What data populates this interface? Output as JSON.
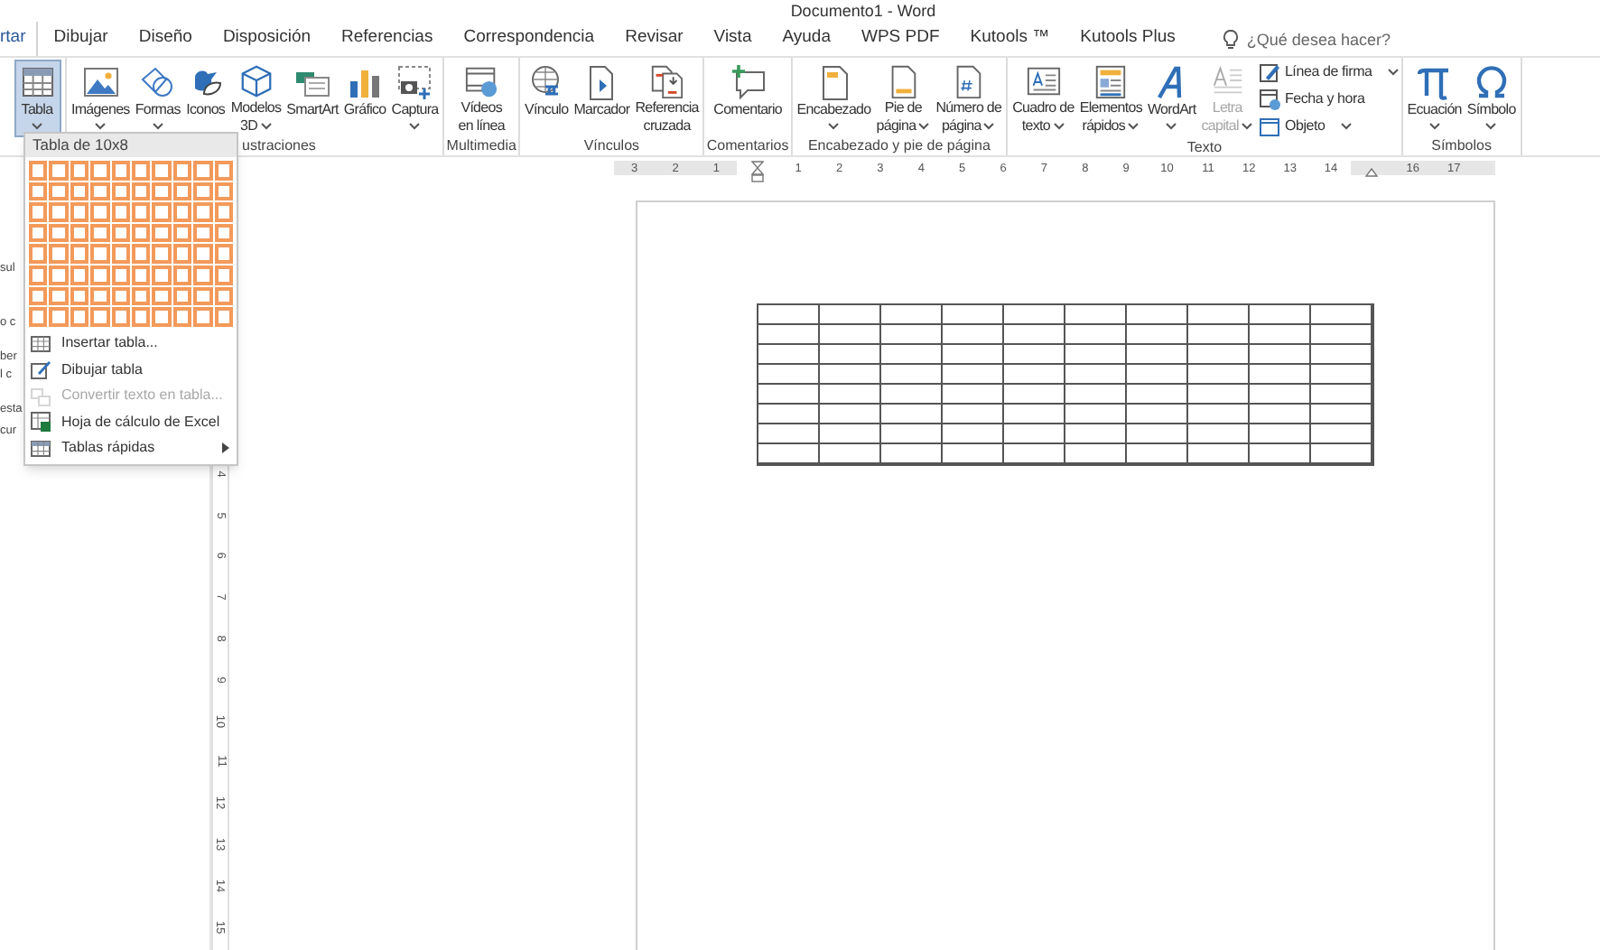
{
  "window": {
    "title": "Documento1 - Word"
  },
  "tabs": [
    {
      "label": "rtar",
      "selected": true
    },
    {
      "label": "Dibujar",
      "selected": false
    },
    {
      "label": "Diseño",
      "selected": false
    },
    {
      "label": "Disposición",
      "selected": false
    },
    {
      "label": "Referencias",
      "selected": false
    },
    {
      "label": "Correspondencia",
      "selected": false
    },
    {
      "label": "Revisar",
      "selected": false
    },
    {
      "label": "Vista",
      "selected": false
    },
    {
      "label": "Ayuda",
      "selected": false
    },
    {
      "label": "WPS PDF",
      "selected": false
    },
    {
      "label": "Kutools ™",
      "selected": false
    },
    {
      "label": "Kutools Plus",
      "selected": false
    }
  ],
  "tell_me": {
    "placeholder": "¿Qué desea hacer?"
  },
  "ribbon": {
    "groups": [
      {
        "buttons": [
          {
            "label_lines": [
              "Tabla"
            ],
            "dropdown": true,
            "selected": true,
            "disabled": false
          }
        ]
      },
      {
        "label": "ustraciones",
        "buttons": [
          {
            "label_lines": [
              "Imágenes"
            ],
            "dropdown": true,
            "selected": false,
            "disabled": false
          },
          {
            "label_lines": [
              "Formas"
            ],
            "dropdown": true,
            "selected": false,
            "disabled": false
          },
          {
            "label_lines": [
              "Iconos"
            ],
            "dropdown": false,
            "selected": false,
            "disabled": false
          },
          {
            "label_lines": [
              "Modelos",
              "3D"
            ],
            "dropdown": true,
            "selected": false,
            "disabled": false
          },
          {
            "label_lines": [
              "SmartArt"
            ],
            "dropdown": false,
            "selected": false,
            "disabled": false
          },
          {
            "label_lines": [
              "Gráfico"
            ],
            "dropdown": false,
            "selected": false,
            "disabled": false
          },
          {
            "label_lines": [
              "Captura"
            ],
            "dropdown": true,
            "selected": false,
            "disabled": false
          }
        ]
      },
      {
        "label": "Multimedia",
        "buttons": [
          {
            "label_lines": [
              "Vídeos",
              "en línea"
            ],
            "dropdown": false,
            "selected": false,
            "disabled": false
          }
        ]
      },
      {
        "label": "Vínculos",
        "buttons": [
          {
            "label_lines": [
              "Vínculo"
            ],
            "dropdown": false,
            "selected": false,
            "disabled": false
          },
          {
            "label_lines": [
              "Marcador"
            ],
            "dropdown": false,
            "selected": false,
            "disabled": false
          },
          {
            "label_lines": [
              "Referencia",
              "cruzada"
            ],
            "dropdown": false,
            "selected": false,
            "disabled": false
          }
        ]
      },
      {
        "label": "Comentarios",
        "buttons": [
          {
            "label_lines": [
              "Comentario"
            ],
            "dropdown": false,
            "selected": false,
            "disabled": false
          }
        ]
      },
      {
        "label": "Encabezado y pie de página",
        "buttons": [
          {
            "label_lines": [
              "Encabezado"
            ],
            "dropdown": true,
            "selected": false,
            "disabled": false
          },
          {
            "label_lines": [
              "Pie de",
              "página"
            ],
            "dropdown": true,
            "selected": false,
            "disabled": false
          },
          {
            "label_lines": [
              "Número de",
              "página"
            ],
            "dropdown": true,
            "selected": false,
            "disabled": false
          }
        ]
      },
      {
        "label": "Texto",
        "buttons": [
          {
            "label_lines": [
              "Cuadro de",
              "texto"
            ],
            "dropdown": true,
            "selected": false,
            "disabled": false
          },
          {
            "label_lines": [
              "Elementos",
              "rápidos"
            ],
            "dropdown": true,
            "selected": false,
            "disabled": false
          },
          {
            "label_lines": [
              "WordArt"
            ],
            "dropdown": true,
            "selected": false,
            "disabled": false
          },
          {
            "label_lines": [
              "Letra",
              "capital"
            ],
            "dropdown": true,
            "selected": false,
            "disabled": true
          }
        ],
        "small_buttons": [
          {
            "label": "Línea de firma",
            "dropdown": true
          },
          {
            "label": "Fecha y hora",
            "dropdown": false
          },
          {
            "label": "Objeto",
            "dropdown": true
          }
        ]
      },
      {
        "label": "Símbolos",
        "buttons": [
          {
            "label_lines": [
              "Ecuación"
            ],
            "dropdown": true,
            "selected": false,
            "disabled": false
          },
          {
            "label_lines": [
              "Símbolo"
            ],
            "dropdown": true,
            "selected": false,
            "disabled": false
          }
        ]
      }
    ]
  },
  "table_menu": {
    "header": "Tabla de 10x8",
    "grid": [
      {
        "cells": [
          {
            "highlighted": true
          },
          {
            "highlighted": true
          },
          {
            "highlighted": true
          },
          {
            "highlighted": true
          },
          {
            "highlighted": true
          },
          {
            "highlighted": true
          },
          {
            "highlighted": true
          },
          {
            "highlighted": true
          },
          {
            "highlighted": true
          },
          {
            "highlighted": true
          }
        ]
      },
      {
        "cells": [
          {
            "highlighted": true
          },
          {
            "highlighted": true
          },
          {
            "highlighted": true
          },
          {
            "highlighted": true
          },
          {
            "highlighted": true
          },
          {
            "highlighted": true
          },
          {
            "highlighted": true
          },
          {
            "highlighted": true
          },
          {
            "highlighted": true
          },
          {
            "highlighted": true
          }
        ]
      },
      {
        "cells": [
          {
            "highlighted": true
          },
          {
            "highlighted": true
          },
          {
            "highlighted": true
          },
          {
            "highlighted": true
          },
          {
            "highlighted": true
          },
          {
            "highlighted": true
          },
          {
            "highlighted": true
          },
          {
            "highlighted": true
          },
          {
            "highlighted": true
          },
          {
            "highlighted": true
          }
        ]
      },
      {
        "cells": [
          {
            "highlighted": true
          },
          {
            "highlighted": true
          },
          {
            "highlighted": true
          },
          {
            "highlighted": true
          },
          {
            "highlighted": true
          },
          {
            "highlighted": true
          },
          {
            "highlighted": true
          },
          {
            "highlighted": true
          },
          {
            "highlighted": true
          },
          {
            "highlighted": true
          }
        ]
      },
      {
        "cells": [
          {
            "highlighted": true
          },
          {
            "highlighted": true
          },
          {
            "highlighted": true
          },
          {
            "highlighted": true
          },
          {
            "highlighted": true
          },
          {
            "highlighted": true
          },
          {
            "highlighted": true
          },
          {
            "highlighted": true
          },
          {
            "highlighted": true
          },
          {
            "highlighted": true
          }
        ]
      },
      {
        "cells": [
          {
            "highlighted": true
          },
          {
            "highlighted": true
          },
          {
            "highlighted": true
          },
          {
            "highlighted": true
          },
          {
            "highlighted": true
          },
          {
            "highlighted": true
          },
          {
            "highlighted": true
          },
          {
            "highlighted": true
          },
          {
            "highlighted": true
          },
          {
            "highlighted": true
          }
        ]
      },
      {
        "cells": [
          {
            "highlighted": true
          },
          {
            "highlighted": true
          },
          {
            "highlighted": true
          },
          {
            "highlighted": true
          },
          {
            "highlighted": true
          },
          {
            "highlighted": true
          },
          {
            "highlighted": true
          },
          {
            "highlighted": true
          },
          {
            "highlighted": true
          },
          {
            "highlighted": true
          }
        ]
      },
      {
        "cells": [
          {
            "highlighted": true
          },
          {
            "highlighted": true
          },
          {
            "highlighted": true
          },
          {
            "highlighted": true
          },
          {
            "highlighted": true
          },
          {
            "highlighted": true
          },
          {
            "highlighted": true
          },
          {
            "highlighted": true
          },
          {
            "highlighted": true
          },
          {
            "highlighted": true
          }
        ]
      }
    ],
    "items": [
      {
        "label": "Insertar tabla...",
        "disabled": false,
        "submenu": false
      },
      {
        "label": "Dibujar tabla",
        "disabled": false,
        "submenu": false
      },
      {
        "label": "Convertir texto en tabla...",
        "disabled": true,
        "submenu": false
      },
      {
        "label": "Hoja de cálculo de Excel",
        "disabled": false,
        "submenu": false
      },
      {
        "label": "Tablas rápidas",
        "disabled": false,
        "submenu": true
      }
    ]
  },
  "navigation_pane_fragments": [
    "sul",
    "o c",
    "ber",
    "l c",
    "esta",
    "cur"
  ],
  "horizontal_ruler": [
    {
      "kind": "number",
      "label": "3"
    },
    {
      "kind": "number",
      "label": "2"
    },
    {
      "kind": "number",
      "label": "1"
    },
    {
      "kind": "indent"
    },
    {
      "kind": "number",
      "label": "1"
    },
    {
      "kind": "number",
      "label": "2"
    },
    {
      "kind": "number",
      "label": "3"
    },
    {
      "kind": "number",
      "label": "4"
    },
    {
      "kind": "number",
      "label": "5"
    },
    {
      "kind": "number",
      "label": "6"
    },
    {
      "kind": "number",
      "label": "7"
    },
    {
      "kind": "number",
      "label": "8"
    },
    {
      "kind": "number",
      "label": "9"
    },
    {
      "kind": "number",
      "label": "10"
    },
    {
      "kind": "number",
      "label": "11"
    },
    {
      "kind": "number",
      "label": "12"
    },
    {
      "kind": "number",
      "label": "13"
    },
    {
      "kind": "number",
      "label": "14"
    },
    {
      "kind": "margin"
    },
    {
      "kind": "number",
      "label": "16"
    },
    {
      "kind": "number",
      "label": "17"
    }
  ],
  "vertical_ruler": [
    "4",
    "5",
    "6",
    "7",
    "8",
    "9",
    "10",
    "11",
    "12",
    "13",
    "14",
    "15"
  ]
}
